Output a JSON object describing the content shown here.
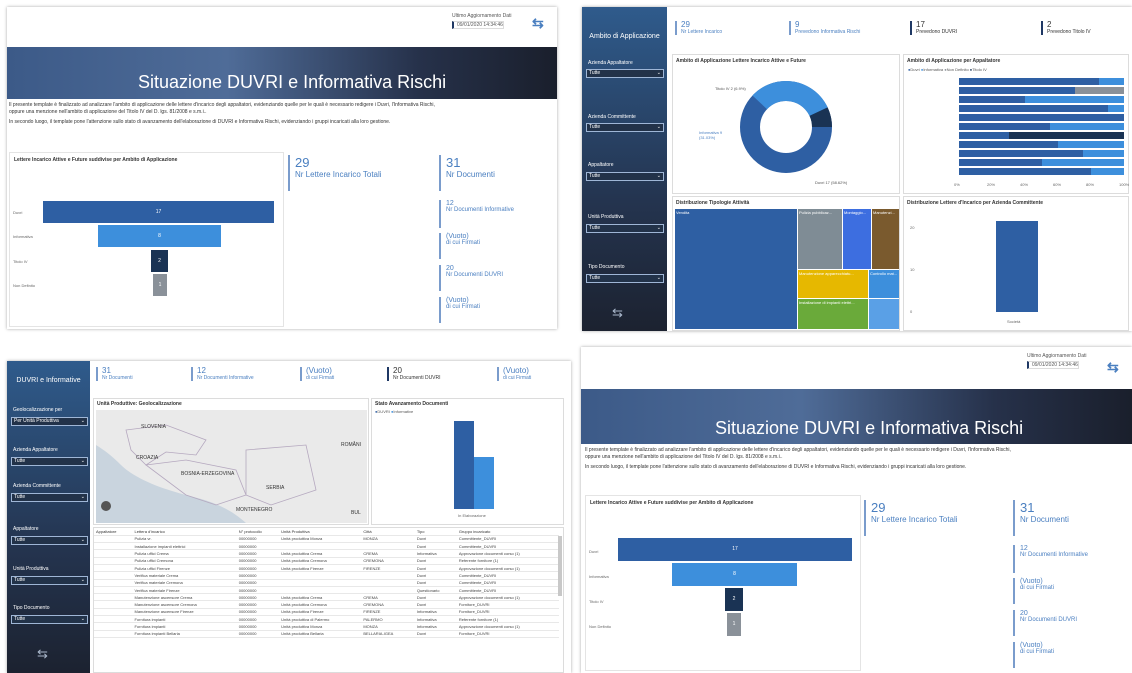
{
  "report": {
    "update_label": "Ultimo Aggiornamento Dati",
    "update_value": "09/01/2020 14:34:46",
    "title": "Situazione DUVRI e Informativa Rischi",
    "desc1": "Il presente template è finalizzato ad analizzare l'ambito di applicazione delle lettere d'incarico degli appaltatori, evidenziando quelle per le quali è necessario redigere i Duvri, l'Informativa Rischi,",
    "desc2": "oppure una menzione nell'ambito di applicazione del Titolo IV del D. lgs. 81/2008 e s.m.i..",
    "desc3": "In secondo luogo, il template pone l'attenzione sullo stato di avanzamento dell'elaborazione di DUVRI e Informativa Rischi, evidenziando i gruppi incaricati alla loro gestione.",
    "funnel_title": "Lettere Incarico Attive e Future suddivise per Ambito di Applicazione",
    "funnel": [
      {
        "label": "Duvri",
        "value": "17",
        "color": "#2e5fa3"
      },
      {
        "label": "Informativa",
        "value": "8",
        "color": "#3d8fdc"
      },
      {
        "label": "Titolo IV",
        "value": "2",
        "color": "#1a3354"
      },
      {
        "label": "Non Definito",
        "value": "1",
        "color": "#8a9199"
      }
    ],
    "kpi_total": {
      "value": "29",
      "label": "Nr Lettere Incarico Totali"
    },
    "kpi_docs": {
      "value": "31",
      "label": "Nr Documenti"
    },
    "kpi_list": [
      {
        "value": "12",
        "label": "Nr Documenti Informative"
      },
      {
        "value": "(Vuoto)",
        "label": "di cui Firmati"
      },
      {
        "value": "20",
        "label": "Nr Documenti DUVRI"
      },
      {
        "value": "(Vuoto)",
        "label": "di cui Firmati"
      }
    ]
  },
  "dash2": {
    "side_title": "Ambito di Applicazione",
    "filters": [
      {
        "label": "Azienda Appaltatore",
        "value": "Tutte"
      },
      {
        "label": "Azienda Committente",
        "value": "Tutte"
      },
      {
        "label": "Appaltatore",
        "value": "Tutte"
      },
      {
        "label": "Unità Produttiva",
        "value": "Tutte"
      },
      {
        "label": "Tipo Documento",
        "value": "Tutte"
      }
    ],
    "kpis": [
      {
        "value": "29",
        "label": "Nr Lettere Incarico"
      },
      {
        "value": "9",
        "label": "Prevedono Informativa Rischi"
      },
      {
        "value": "17",
        "label": "Prevedono DUVRI"
      },
      {
        "value": "2",
        "label": "Prevedono Titolo IV"
      }
    ],
    "donut_title": "Ambito di Applicazione Lettere Incarico Attive e Future",
    "donut_labels": [
      "Titolo IV 2 (6.9%)",
      "Informativa 9 (31.03%)",
      "Duvri 17 (58.62%)"
    ],
    "bars_title": "Ambito di Applicazione per Appaltatore",
    "bars_legend": [
      "Duvri",
      "Informativa",
      "Non Definito",
      "Titolo IV"
    ],
    "bars_ticks": [
      "0%",
      "20%",
      "40%",
      "60%",
      "80%",
      "100%"
    ],
    "treemap_title": "Distribuzione Tipologie Attività",
    "treemap_cells": [
      "Vendita",
      "Pulizia pubblicaz...",
      "Montaggio...",
      "Manutenzi..."
    ],
    "treemap_extra": [
      "Manutenzione apparecchiatu...",
      "Controllo mat...",
      "Installazione di impianti elettri..."
    ],
    "col_title": "Distribuzione Lettere d'Incarico per Azienda Committente",
    "col_yticks": [
      "20",
      "10",
      "0"
    ],
    "col_category": "Società"
  },
  "dash3": {
    "side_title": "DUVRI e Informative",
    "filters": [
      {
        "label": "Geolocalizzazione per",
        "value": "Per Unità Produttiva"
      },
      {
        "label": "Azienda Appaltatore",
        "value": "Tutte"
      },
      {
        "label": "Azienda Committente",
        "value": "Tutte"
      },
      {
        "label": "Appaltatore",
        "value": "Tutte"
      },
      {
        "label": "Unità Produttiva",
        "value": "Tutte"
      },
      {
        "label": "Tipo Documento",
        "value": "Tutte"
      }
    ],
    "kpis": [
      {
        "value": "31",
        "label": "Nr Documenti"
      },
      {
        "value": "12",
        "label": "Nr Documenti Informative"
      },
      {
        "value": "(Vuoto)",
        "label": "di cui Firmati"
      },
      {
        "value": "20",
        "label": "Nr Documenti DUVRI"
      },
      {
        "value": "(Vuoto)",
        "label": "di cui Firmati"
      }
    ],
    "map_title": "Unità Produttive: Geolocalizzazione",
    "map_labels": [
      "SLOVENIA",
      "CROAZIA",
      "BOSNIA-ERZEGOVINA",
      "SERBIA",
      "MONTENEGRO",
      "ROMÂNI",
      "BUL"
    ],
    "status_title": "Stato Avanzamento Documenti",
    "status_legend": [
      "DUVRI",
      "Informative"
    ],
    "status_category": "In Elaborazione",
    "table_headers": [
      "Appaltatore",
      "Lettera d'incarico",
      "N° protocollo",
      "Unità Produttiva",
      "Città",
      "Tipo",
      "Gruppo incaricato"
    ],
    "table_rows": [
      [
        "",
        "Pulizia vr.",
        "00000000",
        "Unità produttiva Monza",
        "MONZA",
        "Duvri",
        "Committente_DUVRI"
      ],
      [
        "",
        "Installazione impianti elettrici",
        "00000000",
        "",
        "",
        "Duvri",
        "Committente_DUVRI"
      ],
      [
        "",
        "Pulizia uffici Crema",
        "00000000",
        "Unità produttiva Crema",
        "CREMA",
        "Informativa",
        "Approvazione documenti corso (1)"
      ],
      [
        "",
        "Pulizia uffici Cremona",
        "00000000",
        "Unità produttiva Cremona",
        "CREMONA",
        "Duvri",
        "Referente fornitore (1)"
      ],
      [
        "",
        "Pulizia uffici Firenze",
        "00000000",
        "Unità produttiva Firenze",
        "FIRENZE",
        "Duvri",
        "Approvazione documenti corso (1)"
      ],
      [
        "",
        "Verifica materiale Crema",
        "00000000",
        "",
        "",
        "Duvri",
        "Committente_DUVRI"
      ],
      [
        "",
        "Verifica materiale Cremona",
        "00000000",
        "",
        "",
        "Duvri",
        "Committente_DUVRI"
      ],
      [
        "",
        "Verifica materiale Firenze",
        "00000000",
        "",
        "",
        "Questionario",
        "Committente_DUVRI"
      ],
      [
        "",
        "Manutenzione ascensore Crema",
        "00000000",
        "Unità produttiva Crema",
        "CREMA",
        "Duvri",
        "Approvazione documenti corso (1)"
      ],
      [
        "",
        "Manutenzione ascensore Cremona",
        "00000000",
        "Unità produttiva Cremona",
        "CREMONA",
        "Duvri",
        "Fornitore_DUVRI"
      ],
      [
        "",
        "Manutenzione ascensore Firenze",
        "00000000",
        "Unità produttiva Firenze",
        "FIRENZE",
        "Informativa",
        "Fornitore_DUVRI"
      ],
      [
        "",
        "Fornitura impianti",
        "00000000",
        "Unità produttiva di Palermo",
        "PALERMO",
        "Informativa",
        "Referente fornitore (1)"
      ],
      [
        "",
        "Fornitura impianti",
        "00000000",
        "Unità produttiva Monza",
        "MONZA",
        "Informativa",
        "Approvazione documenti corso (1)"
      ],
      [
        "",
        "Fornitura impianti Bellaria",
        "00000000",
        "Unità produttiva Bellaria",
        "BELLARIA-IGEA",
        "Duvri",
        "Fornitore_DUVRI"
      ]
    ]
  },
  "icons": {
    "logo": "logo-arrows-icon",
    "chevron": "chevron-down-icon"
  }
}
